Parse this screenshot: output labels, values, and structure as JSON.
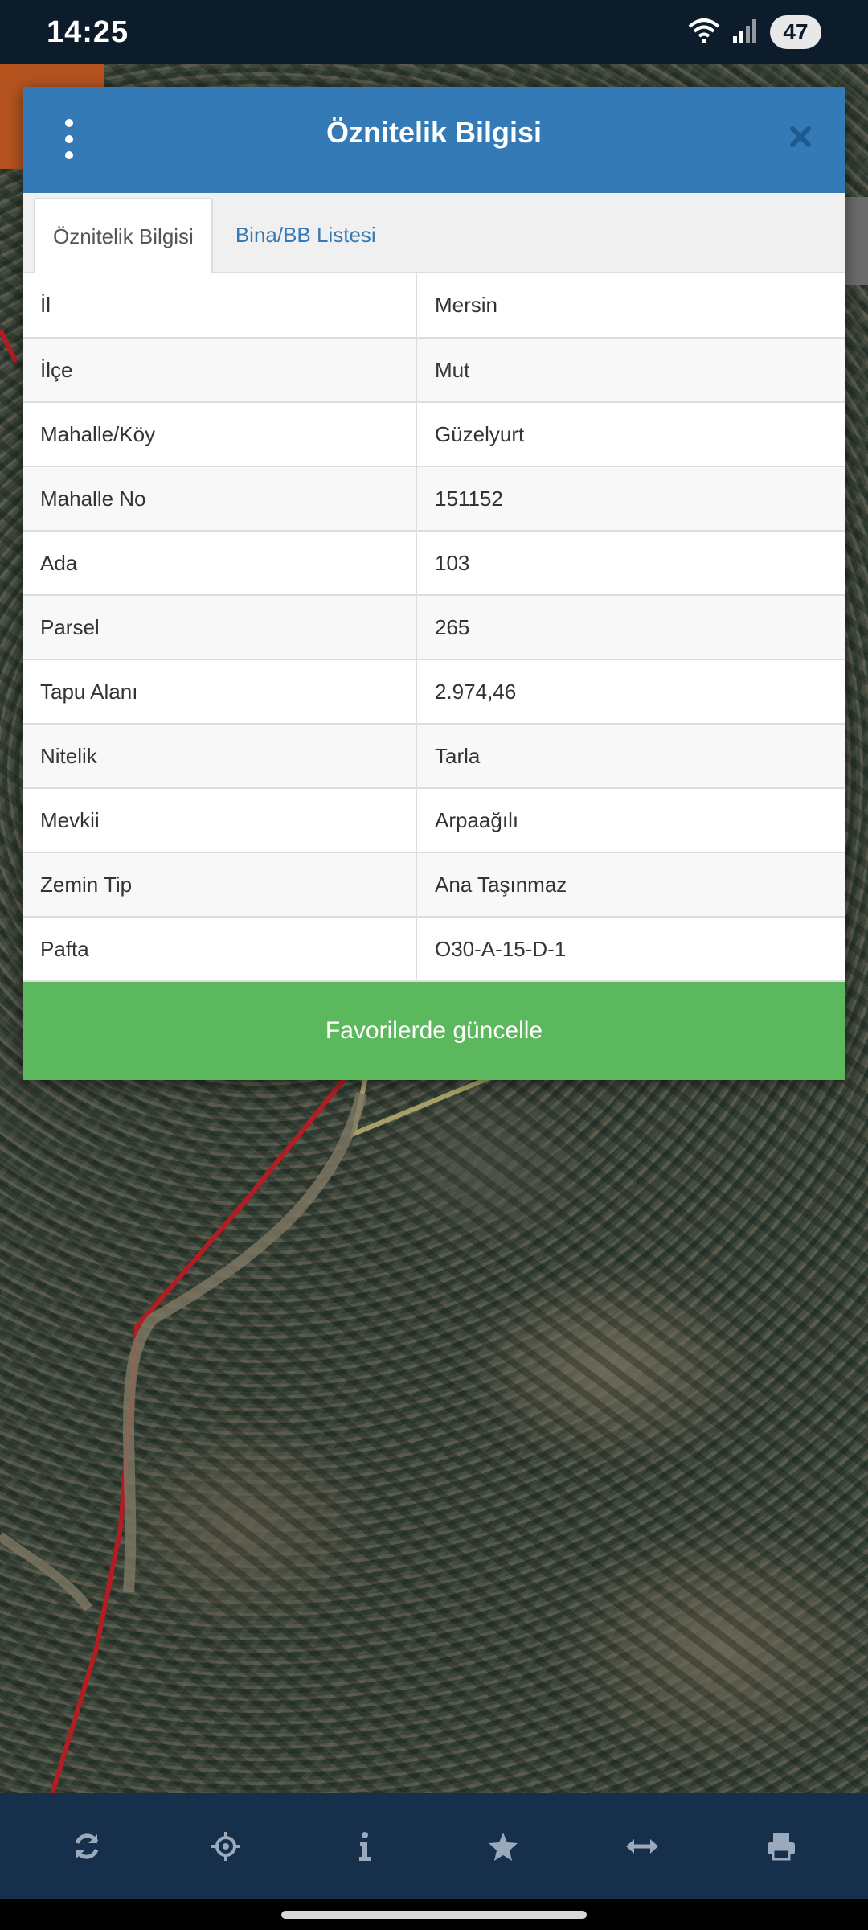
{
  "status_bar": {
    "time": "14:25",
    "battery": "47",
    "icons": [
      "wifi-icon",
      "signal-icon"
    ]
  },
  "modal": {
    "title": "Öznitelik Bilgisi",
    "menu_icon": "kebab-menu-icon",
    "close_icon": "close-icon",
    "tabs": [
      {
        "label": "Öznitelik Bilgisi",
        "active": true
      },
      {
        "label": "Bina/BB Listesi",
        "active": false
      }
    ],
    "rows": [
      {
        "label": "İl",
        "value": "Mersin"
      },
      {
        "label": "İlçe",
        "value": "Mut"
      },
      {
        "label": "Mahalle/Köy",
        "value": "Güzelyurt"
      },
      {
        "label": "Mahalle No",
        "value": "151152"
      },
      {
        "label": "Ada",
        "value": "103"
      },
      {
        "label": "Parsel",
        "value": "265"
      },
      {
        "label": "Tapu Alanı",
        "value": "2.974,46"
      },
      {
        "label": "Nitelik",
        "value": "Tarla"
      },
      {
        "label": "Mevkii",
        "value": "Arpaağılı"
      },
      {
        "label": "Zemin Tip",
        "value": "Ana Taşınmaz"
      },
      {
        "label": "Pafta",
        "value": "O30-A-15-D-1"
      }
    ],
    "favorite_button_label": "Favorilerde güncelle"
  },
  "toolbar": {
    "items": [
      "refresh-icon",
      "locate-icon",
      "info-icon",
      "star-icon",
      "measure-icon",
      "print-icon"
    ]
  },
  "colors": {
    "header_blue": "#337ab7",
    "success_green": "#5cb85c",
    "toolbar_navy": "#16304c",
    "status_bar": "#0d1c2a"
  }
}
